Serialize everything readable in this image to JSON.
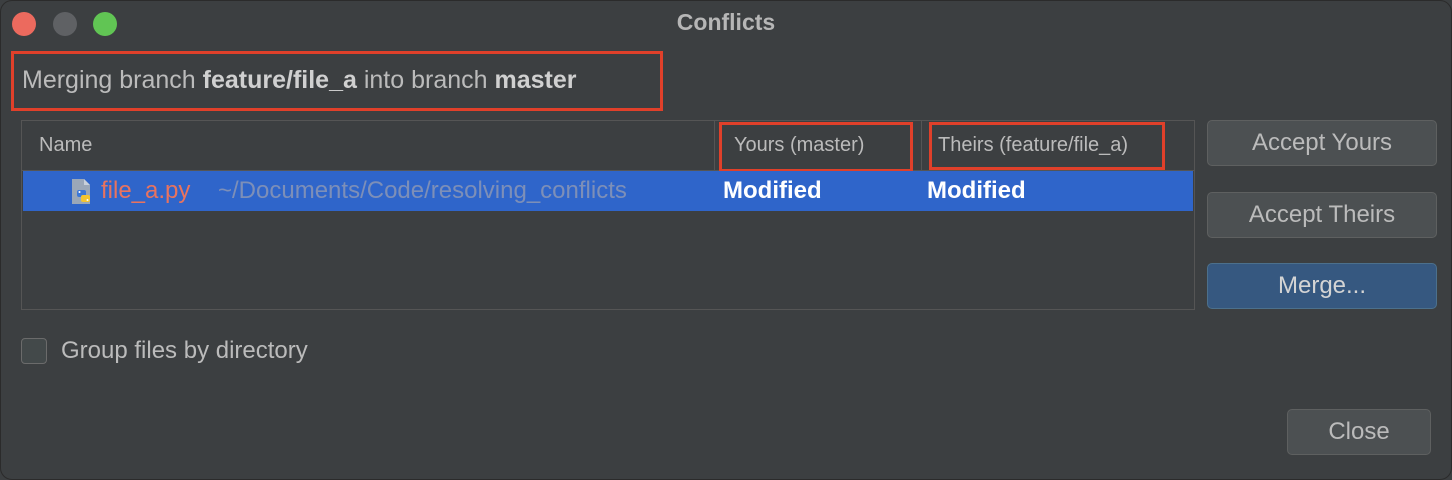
{
  "window": {
    "title": "Conflicts"
  },
  "merge_info": {
    "prefix": "Merging branch ",
    "source_branch": "feature/file_a",
    "middle": " into branch ",
    "target_branch": "master"
  },
  "table": {
    "columns": {
      "name": "Name",
      "yours": "Yours (master)",
      "theirs": "Theirs (feature/file_a)"
    },
    "rows": [
      {
        "icon": "python-file-icon",
        "file_name": "file_a.py",
        "path": "~/Documents/Code/resolving_conflicts",
        "yours": "Modified",
        "theirs": "Modified",
        "selected": true
      }
    ]
  },
  "buttons": {
    "accept_yours": "Accept Yours",
    "accept_theirs": "Accept Theirs",
    "merge": "Merge...",
    "close": "Close"
  },
  "options": {
    "group_by_directory_label": "Group files by directory",
    "group_by_directory_checked": false
  },
  "colors": {
    "highlight_box": "#e0402a",
    "selection": "#2f65ca",
    "file_name": "#e8735f",
    "path": "#7d8fb8"
  }
}
